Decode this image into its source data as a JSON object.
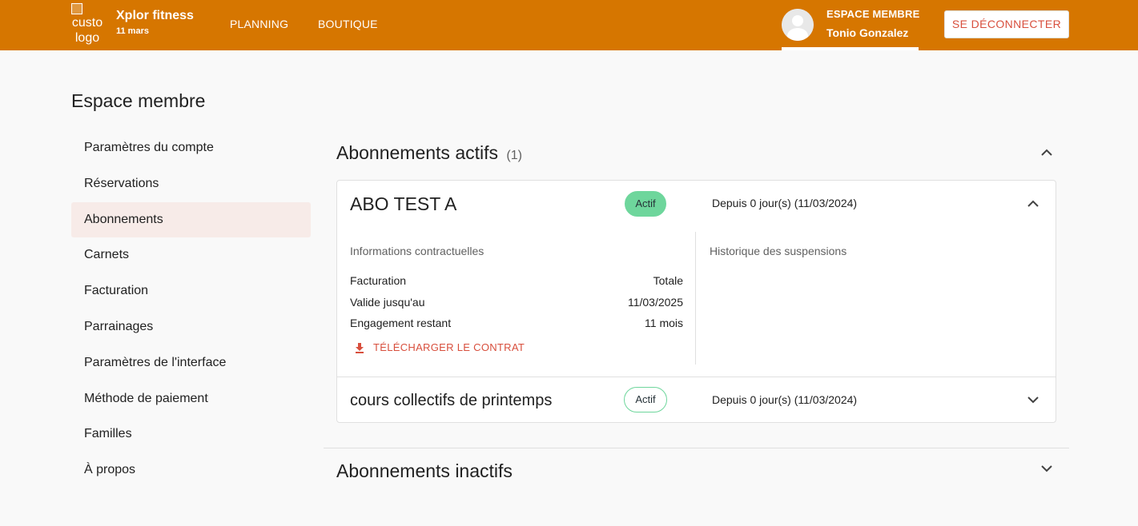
{
  "header": {
    "logo_alt": "custo logo",
    "brand_name": "Xplor fitness",
    "date": "11 mars",
    "nav": {
      "planning": "PLANNING",
      "boutique": "BOUTIQUE"
    },
    "member_title": "ESPACE MEMBRE",
    "member_name": "Tonio Gonzalez",
    "logout_label": "SE DÉCONNECTER"
  },
  "page": {
    "title": "Espace membre"
  },
  "sidebar": {
    "items": [
      {
        "label": "Paramètres du compte"
      },
      {
        "label": "Réservations"
      },
      {
        "label": "Abonnements"
      },
      {
        "label": "Carnets"
      },
      {
        "label": "Facturation"
      },
      {
        "label": "Parrainages"
      },
      {
        "label": "Paramètres de l'interface"
      },
      {
        "label": "Méthode de paiement"
      },
      {
        "label": "Familles"
      },
      {
        "label": "À propos"
      }
    ]
  },
  "active_section": {
    "title": "Abonnements actifs",
    "count": "(1)",
    "subscriptions": [
      {
        "name": "ABO TEST A",
        "status": "Actif",
        "since": "Depuis 0 jour(s) (11/03/2024)",
        "contract_title": "Informations contractuelles",
        "rows": [
          {
            "label": "Facturation",
            "value": "Totale"
          },
          {
            "label": "Valide jusqu'au",
            "value": "11/03/2025"
          },
          {
            "label": "Engagement restant",
            "value": "11 mois"
          }
        ],
        "download_label": "TÉLÉCHARGER LE CONTRAT",
        "history_title": "Historique des suspensions"
      },
      {
        "name": "cours collectifs de printemps",
        "status": "Actif",
        "since": "Depuis 0 jour(s) (11/03/2024)"
      }
    ]
  },
  "inactive_section": {
    "title": "Abonnements inactifs"
  },
  "colors": {
    "brand": "#d67600",
    "accent": "#d84f3d",
    "active_badge": "#6ed69c",
    "active_nav_bg": "#f7ebe8"
  }
}
